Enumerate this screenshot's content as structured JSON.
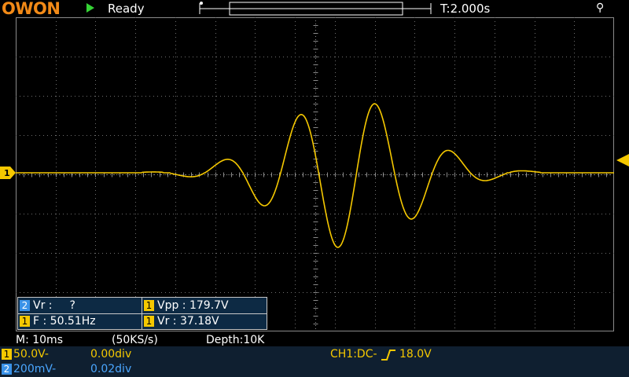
{
  "header": {
    "brand": "OWON",
    "status": "Ready",
    "timebase": "T:2.000s",
    "usb_icon": "usb-icon"
  },
  "measurements": {
    "ch2_vr_label": "Vr :",
    "ch2_vr_value": "?",
    "ch1_vpp": "Vpp : 179.7V",
    "ch1_freq": "F : 50.51Hz",
    "ch1_vr": "Vr : 37.18V",
    "ch1_badge": "1",
    "ch2_badge": "2"
  },
  "acquisition": {
    "timebase": "M: 10ms",
    "sample_rate": "(50KS/s)",
    "depth": "Depth:10K"
  },
  "channels": [
    {
      "num": "1",
      "scale": "50.0V-",
      "offset": "0.00div",
      "color": "#f5c800"
    },
    {
      "num": "2",
      "scale": "200mV-",
      "offset": "0.02div",
      "color": "#4aa6ff"
    }
  ],
  "trigger": {
    "label": "CH1:DC-",
    "level": "18.0V"
  },
  "colors": {
    "ch1": "#f5c800",
    "ch2": "#3a92e8",
    "grid": "#6e6e6e",
    "brand": "#f28a17"
  }
}
